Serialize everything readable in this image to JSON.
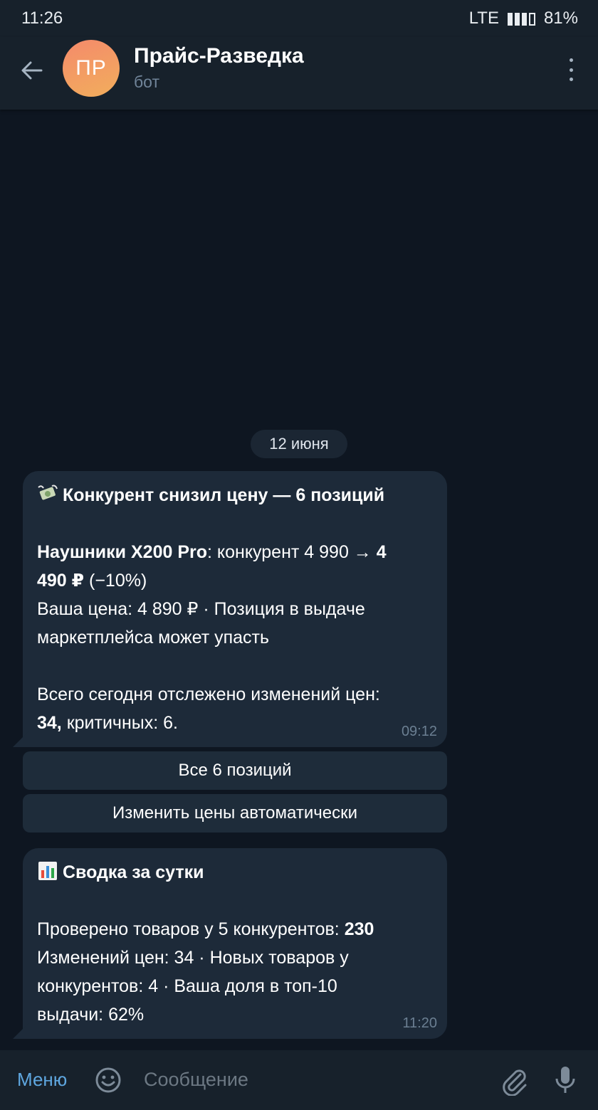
{
  "status": {
    "time": "11:26",
    "network": "LTE",
    "battery": "81%"
  },
  "header": {
    "avatar_initials": "ПР",
    "title": "Прайс-Разведка",
    "subtitle": "бот"
  },
  "date_separator": "12 июня",
  "messages": [
    {
      "title": "Конкурент снизил цену — 6 позиций",
      "emoji": "money-with-wings-icon",
      "line1_bold": "Наушники X200 Pro",
      "line1_rest": ": конкурент 4 990 → ",
      "line1_bold2": "4",
      "line2_bold": "490 ₽",
      "line2_rest": " (−10%)",
      "line3": "Ваша цена: 4 890 ₽ · Позиция в выдаче",
      "line4": "маркетплейса может упасть",
      "line5": "Всего сегодня отслежено изменений цен:",
      "line6_bold": "34,",
      "line6_rest": " критичных: 6.",
      "time": "09:12"
    },
    {
      "title": "Сводка за сутки",
      "emoji": "bar-chart-icon",
      "line1_rest": "Проверено товаров у 5 конкурентов: ",
      "line1_bold": "230",
      "line2": "Изменений цен: 34 · Новых товаров у",
      "line3": "конкурентов: 4 · Ваша доля в топ-10",
      "line4": "выдачи: 62%",
      "time": "11:20"
    }
  ],
  "keyboard": [
    {
      "label": "Все 6 позиций"
    },
    {
      "label": "Изменить цены автоматически"
    }
  ],
  "input": {
    "menu_label": "Меню",
    "placeholder": "Сообщение"
  }
}
